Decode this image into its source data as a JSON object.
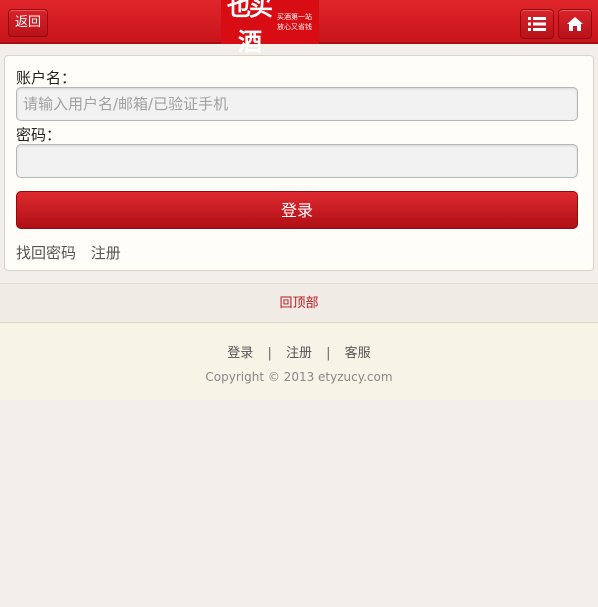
{
  "header": {
    "back_label": "返回",
    "logo_main": "也买酒",
    "logo_sub_line1": "买酒第一站",
    "logo_sub_line2": "放心又省钱",
    "menu_icon": "list-icon",
    "home_icon": "home-icon"
  },
  "form": {
    "account_label": "账户名：",
    "account_placeholder": "请输入用户名/邮箱/已验证手机",
    "account_value": "",
    "password_label": "密码：",
    "password_value": "",
    "login_button": "登录",
    "forgot_password": "找回密码",
    "register": "注册"
  },
  "back_to_top": "回顶部",
  "footer": {
    "links": [
      "登录",
      "注册",
      "客服"
    ],
    "separator": "|",
    "copyright": "Copyright © 2013 etyzucy.com"
  },
  "colors": {
    "accent": "#d80d13",
    "background": "#f2efea"
  }
}
